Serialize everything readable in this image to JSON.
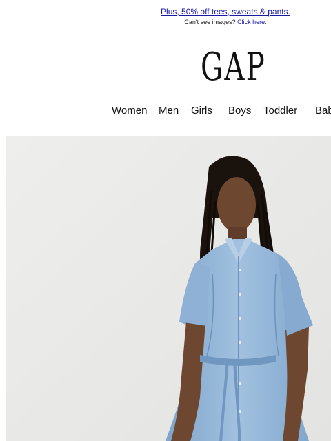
{
  "preheader": {
    "promo_link": "Plus, 50% off tees, sweats & pants.",
    "cant_see_text": "Can't see images?",
    "click_here": "Click here",
    "period": "."
  },
  "logo": {
    "text": "GAP"
  },
  "nav": {
    "items": [
      {
        "label": "Women"
      },
      {
        "label": "Men"
      },
      {
        "label": "Girls"
      },
      {
        "label": "Boys"
      },
      {
        "label": "Toddler"
      },
      {
        "label": "Baby"
      }
    ]
  },
  "colors": {
    "link": "#1a1aa6",
    "hero_bg": "#e7e7e5",
    "denim": "#8fb3d6",
    "skin": "#6e4731",
    "hair": "#1a120d"
  },
  "hero": {
    "subject": "woman in light denim shirt dress"
  }
}
